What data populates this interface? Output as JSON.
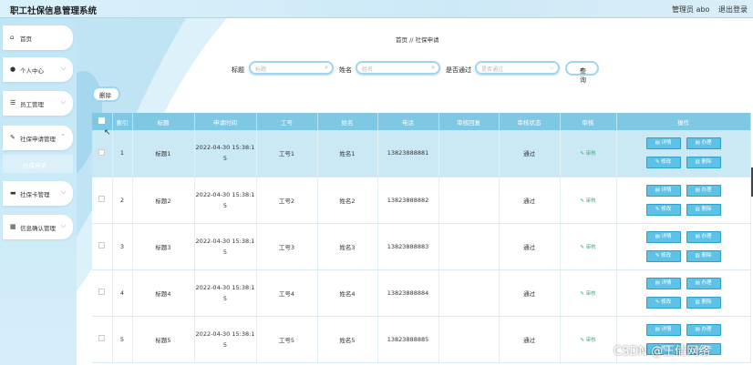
{
  "header": {
    "title": "职工社保信息管理系统",
    "admin": "管理员 abo",
    "logout": "退出登录"
  },
  "sidebar": {
    "items": [
      {
        "label": "首页",
        "icon": "home-icon"
      },
      {
        "label": "个人中心",
        "icon": "user-icon"
      },
      {
        "label": "员工管理",
        "icon": "list-icon"
      },
      {
        "label": "社保申请管理",
        "icon": "pen-icon"
      },
      {
        "label": "社保卡管理",
        "icon": "card-icon"
      },
      {
        "label": "信息确认管理",
        "icon": "grid-icon"
      }
    ],
    "sub_item": "社保申请"
  },
  "breadcrumb": "首页 // 社保申请",
  "search": {
    "title_label": "标题",
    "title_placeholder": "标题",
    "name_label": "姓名",
    "name_placeholder": "姓名",
    "pass_label": "是否通过",
    "pass_placeholder": "是否通过",
    "query_label": "查询"
  },
  "delete_label": "删除",
  "table": {
    "headers": [
      "索引",
      "标题",
      "申请时间",
      "工号",
      "姓名",
      "电话",
      "审核回复",
      "审核状态",
      "审核",
      "操作"
    ],
    "audit_label": "审核",
    "ops": [
      "详情",
      "办理",
      "修改",
      "删除"
    ],
    "rows": [
      {
        "index": "1",
        "title": "标题1",
        "time1": "2022-04-30 15:38:1",
        "time2": "5",
        "job": "工号1",
        "name": "姓名1",
        "phone": "13823888881",
        "reply": "",
        "status": "通过"
      },
      {
        "index": "2",
        "title": "标题2",
        "time1": "2022-04-30 15:38:1",
        "time2": "5",
        "job": "工号2",
        "name": "姓名2",
        "phone": "13823888882",
        "reply": "",
        "status": "通过"
      },
      {
        "index": "3",
        "title": "标题3",
        "time1": "2022-04-30 15:38:1",
        "time2": "5",
        "job": "工号3",
        "name": "姓名3",
        "phone": "13823888883",
        "reply": "",
        "status": "通过"
      },
      {
        "index": "4",
        "title": "标题4",
        "time1": "2022-04-30 15:38:1",
        "time2": "5",
        "job": "工号4",
        "name": "姓名4",
        "phone": "13823888884",
        "reply": "",
        "status": "通过"
      },
      {
        "index": "5",
        "title": "标题5",
        "time1": "2022-04-30 15:38:1",
        "time2": "5",
        "job": "工号5",
        "name": "姓名5",
        "phone": "13823888885",
        "reply": "",
        "status": "通过"
      }
    ]
  },
  "watermark": "CSDN @王倩网络",
  "colors": {
    "accent": "#7ec8e3",
    "button": "#5ec2e6",
    "sidebar": "#bfe6f6",
    "audit": "#2bb673"
  }
}
